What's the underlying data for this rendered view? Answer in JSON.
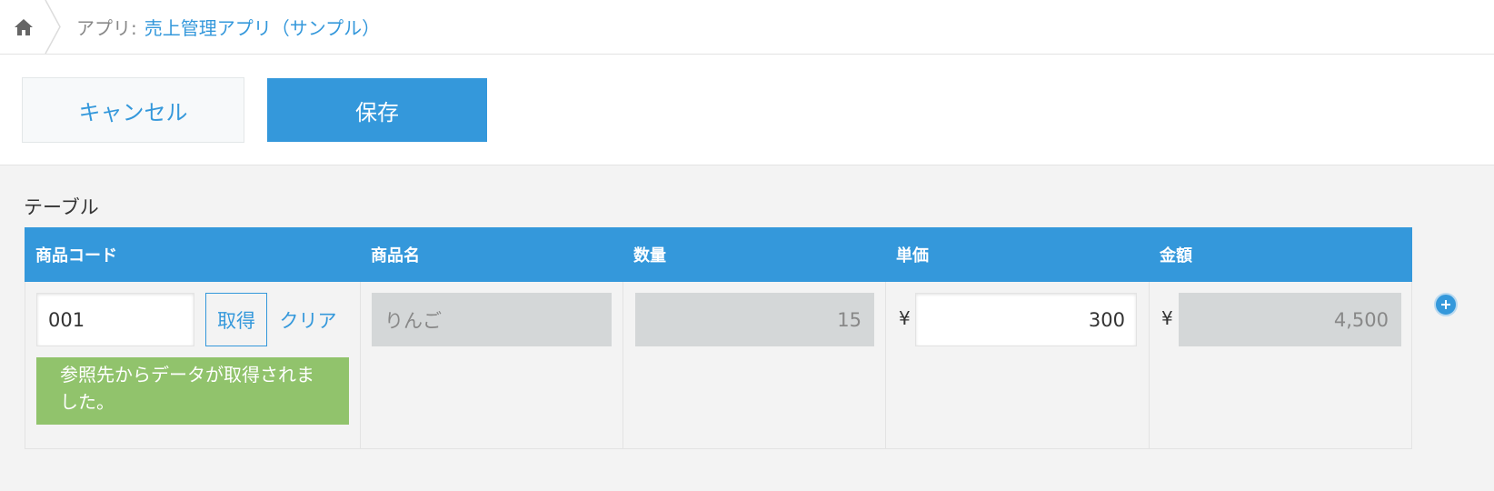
{
  "breadcrumb": {
    "home_icon": "home-icon",
    "prefix": "アプリ:",
    "app_name": "売上管理アプリ（サンプル）"
  },
  "toolbar": {
    "cancel_label": "キャンセル",
    "save_label": "保存"
  },
  "table": {
    "label": "テーブル",
    "columns": [
      "商品コード",
      "商品名",
      "数量",
      "単価",
      "金額"
    ],
    "rows": [
      {
        "code": "001",
        "get_label": "取得",
        "clear_label": "クリア",
        "lookup_message": "参照先からデータが取得されました。",
        "name": "りんご",
        "quantity": "15",
        "currency": "¥",
        "unit_price": "300",
        "amount": "4,500"
      }
    ],
    "add_row_icon": "plus-icon"
  },
  "colors": {
    "accent": "#3498db",
    "success": "#91c36c",
    "disabled": "#d4d7d8",
    "background": "#f3f3f3"
  }
}
